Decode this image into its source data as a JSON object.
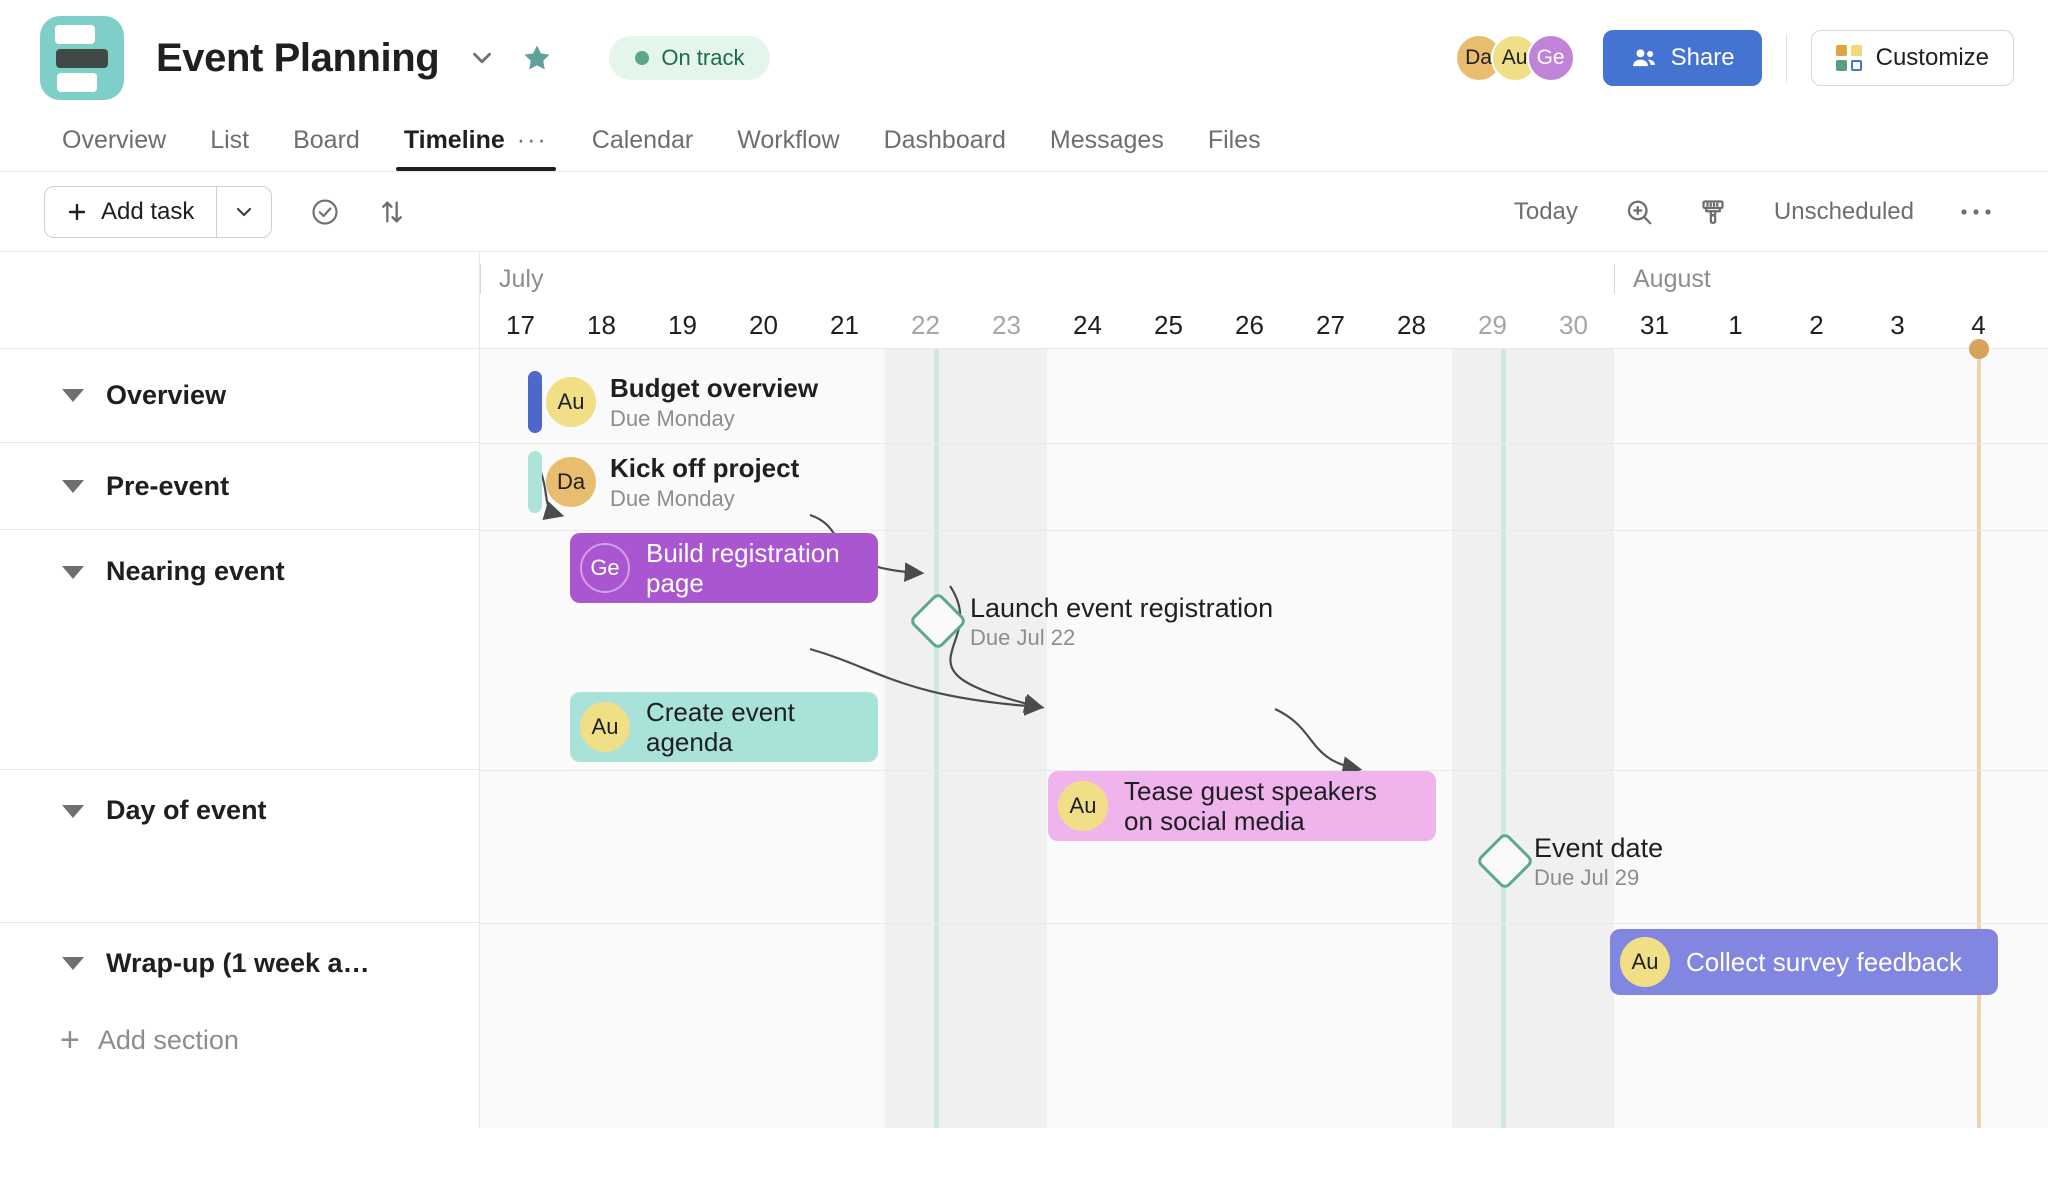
{
  "header": {
    "project_icon": "project-board-icon",
    "title": "Event Planning",
    "chevron": "chevron-down-icon",
    "star": "star-icon",
    "status": "On track",
    "avatars": [
      {
        "initials": "Da",
        "color": "#e8bd70"
      },
      {
        "initials": "Au",
        "color": "#f0df86"
      },
      {
        "initials": "Ge",
        "color": "#c183d8"
      }
    ],
    "share_label": "Share",
    "customize_label": "Customize"
  },
  "tabs": [
    {
      "label": "Overview",
      "active": false
    },
    {
      "label": "List",
      "active": false
    },
    {
      "label": "Board",
      "active": false
    },
    {
      "label": "Timeline",
      "active": true,
      "overflow": "···"
    },
    {
      "label": "Calendar",
      "active": false
    },
    {
      "label": "Workflow",
      "active": false
    },
    {
      "label": "Dashboard",
      "active": false
    },
    {
      "label": "Messages",
      "active": false
    },
    {
      "label": "Files",
      "active": false
    }
  ],
  "toolbar": {
    "add_task": "Add task",
    "add_task_caret": "chevron-down-icon",
    "filter_icon": "check-circle-icon",
    "sort_icon": "sort-arrows-icon",
    "today": "Today",
    "zoom_icon": "zoom-in-icon",
    "color_icon": "paintbrush-icon",
    "unscheduled": "Unscheduled",
    "more_icon": "ellipsis-icon"
  },
  "timeline": {
    "months": [
      {
        "label": "July",
        "start_day_index": 0
      },
      {
        "label": "August",
        "start_day_index": 14
      }
    ],
    "days": [
      {
        "num": "17",
        "weekend": false
      },
      {
        "num": "18",
        "weekend": false
      },
      {
        "num": "19",
        "weekend": false
      },
      {
        "num": "20",
        "weekend": false
      },
      {
        "num": "21",
        "weekend": false
      },
      {
        "num": "22",
        "weekend": true
      },
      {
        "num": "23",
        "weekend": true
      },
      {
        "num": "24",
        "weekend": false
      },
      {
        "num": "25",
        "weekend": false
      },
      {
        "num": "26",
        "weekend": false
      },
      {
        "num": "27",
        "weekend": false
      },
      {
        "num": "28",
        "weekend": false
      },
      {
        "num": "29",
        "weekend": true
      },
      {
        "num": "30",
        "weekend": true
      },
      {
        "num": "31",
        "weekend": false
      },
      {
        "num": "1",
        "weekend": false
      },
      {
        "num": "2",
        "weekend": false
      },
      {
        "num": "3",
        "weekend": false
      },
      {
        "num": "4",
        "weekend": false
      }
    ],
    "today_day_index": 18,
    "marker_day_indices": [
      5,
      12
    ]
  },
  "sections": [
    {
      "name": "Overview"
    },
    {
      "name": "Pre-event"
    },
    {
      "name": "Nearing event"
    },
    {
      "name": "Day of event"
    },
    {
      "name": "Wrap-up (1 week a…"
    }
  ],
  "add_section": "Add section",
  "tasks": [
    {
      "id": "budget-overview",
      "name": "Budget overview",
      "due": "Due Monday",
      "assignee": "Au",
      "assignee_color": "#f0df86",
      "bar_color": "#4d68c8",
      "style": "stub",
      "text_color": "#1e1f21"
    },
    {
      "id": "kick-off-project",
      "name": "Kick off project",
      "due": "Due Monday",
      "assignee": "Da",
      "assignee_color": "#e8bd70",
      "bar_color": "#aee3dc",
      "style": "stub",
      "text_color": "#1e1f21"
    },
    {
      "id": "build-registration-page",
      "name": "Build registration\npage",
      "due": "",
      "assignee": "Ge",
      "assignee_color": "transparent",
      "bar_color": "#a956d0",
      "style": "bar",
      "text_color": "#ffffff"
    },
    {
      "id": "launch-event-registration",
      "name": "Launch event registration",
      "due": "Due Jul 22",
      "assignee": "",
      "assignee_color": "",
      "bar_color": "#5da795",
      "style": "milestone",
      "text_color": "#1e1f21"
    },
    {
      "id": "create-event-agenda",
      "name": "Create event\nagenda",
      "due": "",
      "assignee": "Au",
      "assignee_color": "#f0df86",
      "bar_color": "#a8e2d8",
      "style": "bar",
      "text_color": "#1e1f21"
    },
    {
      "id": "tease-guest-speakers",
      "name": "Tease guest speakers\non social media",
      "due": "",
      "assignee": "Au",
      "assignee_color": "#f0df86",
      "bar_color": "#f0b4ed",
      "style": "bar",
      "text_color": "#1e1f21"
    },
    {
      "id": "event-date",
      "name": "Event date",
      "due": "Due Jul 29",
      "assignee": "",
      "assignee_color": "",
      "bar_color": "#5da795",
      "style": "milestone",
      "text_color": "#1e1f21"
    },
    {
      "id": "collect-survey-feedback",
      "name": "Collect survey feedback",
      "due": "",
      "assignee": "Au",
      "assignee_color": "#f0df86",
      "bar_color": "#8187e0",
      "style": "bar",
      "text_color": "#ffffff"
    }
  ]
}
